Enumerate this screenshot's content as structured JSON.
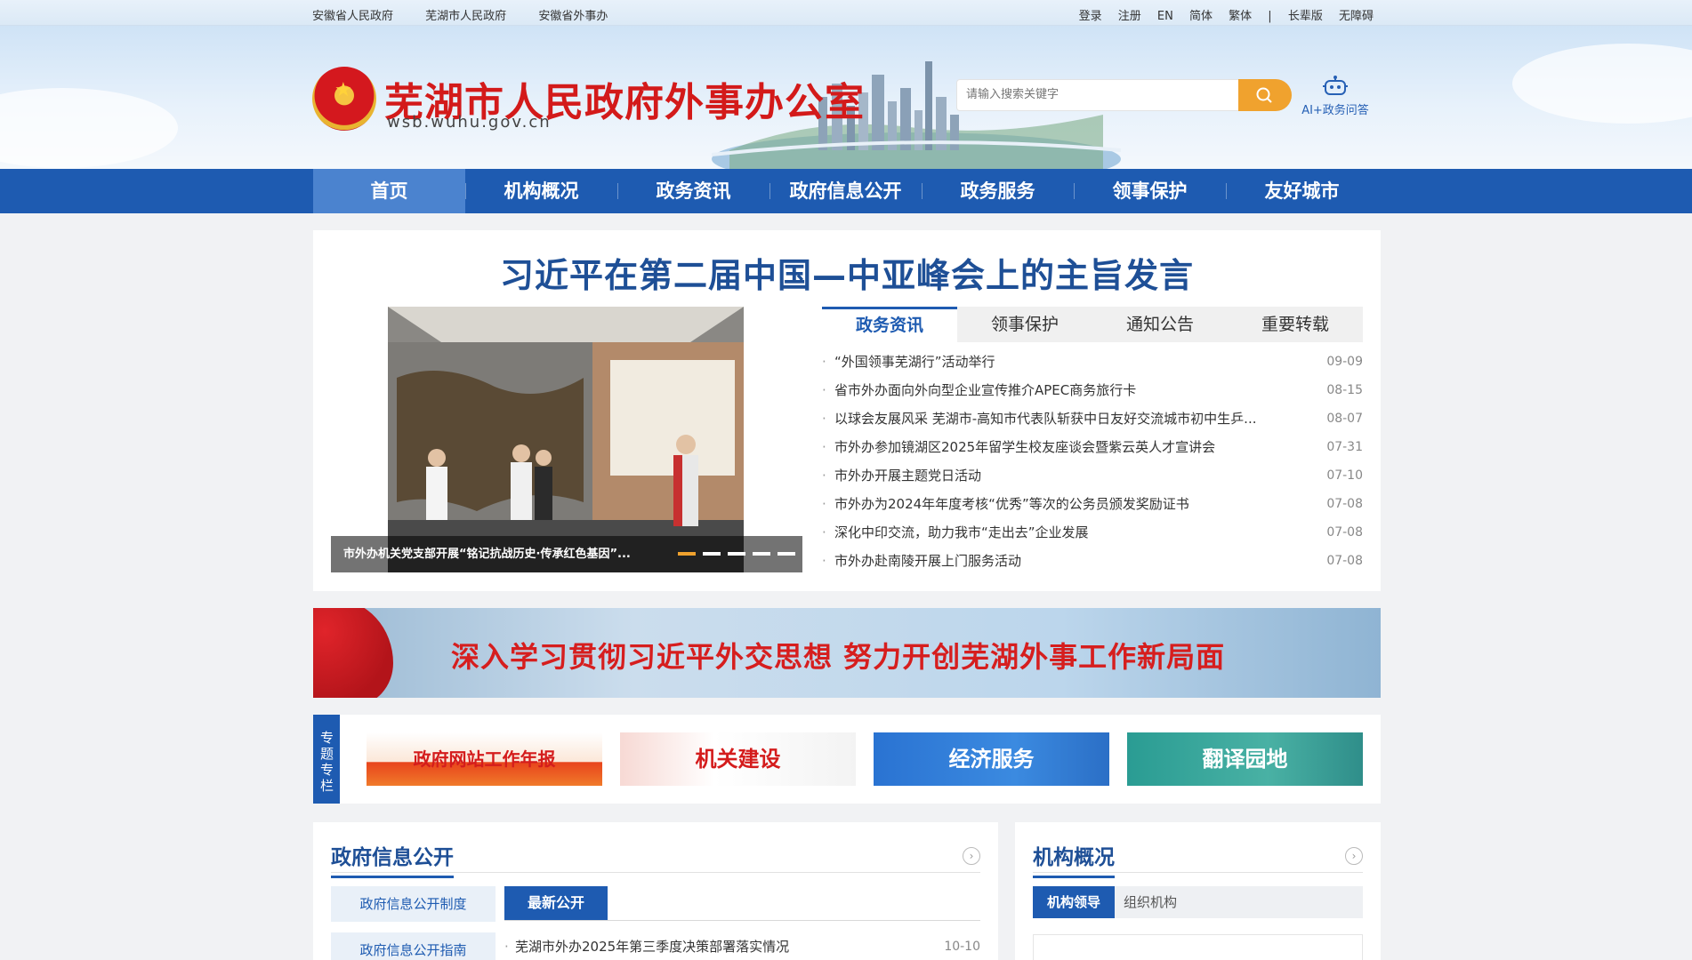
{
  "topbar": {
    "left_links": [
      "安徽省人民政府",
      "芜湖市人民政府",
      "安徽省外事办"
    ],
    "right_links": [
      "登录",
      "注册",
      "EN",
      "简体",
      "繁体",
      "|",
      "长辈版",
      "无障碍"
    ]
  },
  "header": {
    "title": "芜湖市人民政府外事办公室",
    "url": "wsb.wuhu.gov.cn",
    "search_placeholder": "请输入搜索关键字",
    "ai_label": "AI+政务问答"
  },
  "nav": {
    "items": [
      "首页",
      "机构概况",
      "政务资讯",
      "政府信息公开",
      "政务服务",
      "领事保护",
      "友好城市"
    ],
    "active": "首页"
  },
  "headline": {
    "title": "习近平在第二届中国—中亚峰会上的主旨发言",
    "photo_caption": "市外办机关党支部开展“铭记抗战历史·传承红色基因”..."
  },
  "news_tabs": [
    "政务资讯",
    "领事保护",
    "通知公告",
    "重要转载"
  ],
  "news": [
    {
      "title": "“外国领事芜湖行”活动举行",
      "date": "09-09"
    },
    {
      "title": "省市外办面向外向型企业宣传推介APEC商务旅行卡",
      "date": "08-15"
    },
    {
      "title": "以球会友展风采 芜湖市-高知市代表队斩获中日友好交流城市初中生乒...",
      "date": "08-07"
    },
    {
      "title": "市外办参加镜湖区2025年留学生校友座谈会暨紫云英人才宣讲会",
      "date": "07-31"
    },
    {
      "title": "市外办开展主题党日活动",
      "date": "07-10"
    },
    {
      "title": "市外办为2024年年度考核“优秀”等次的公务员颁发奖励证书",
      "date": "07-08"
    },
    {
      "title": "深化中印交流，助力我市“走出去”企业发展",
      "date": "07-08"
    },
    {
      "title": "市外办赴南陵开展上门服务活动",
      "date": "07-08"
    }
  ],
  "banner": {
    "text": "深入学习贯彻习近平外交思想   努力开创芜湖外事工作新局面"
  },
  "special": {
    "label": "专题专栏",
    "items": [
      "政府网站工作年报",
      "机关建设",
      "经济服务",
      "翻译园地"
    ]
  },
  "gov_info": {
    "title": "政府信息公开",
    "side_items": [
      "政府信息公开制度",
      "政府信息公开指南"
    ],
    "tab": "最新公开",
    "rows": [
      {
        "title": "芜湖市外办2025年第三季度决策部署落实情况",
        "date": "10-10"
      }
    ]
  },
  "org": {
    "title": "机构概况",
    "tabs": [
      "机构领导",
      "组织机构"
    ]
  },
  "colors": {
    "primary": "#1e5bb1",
    "accent": "#f0a22e",
    "title_red": "#d31a1a"
  },
  "icons": {
    "search": "search-icon",
    "robot": "robot-icon",
    "more": "chevron-right-icon"
  }
}
